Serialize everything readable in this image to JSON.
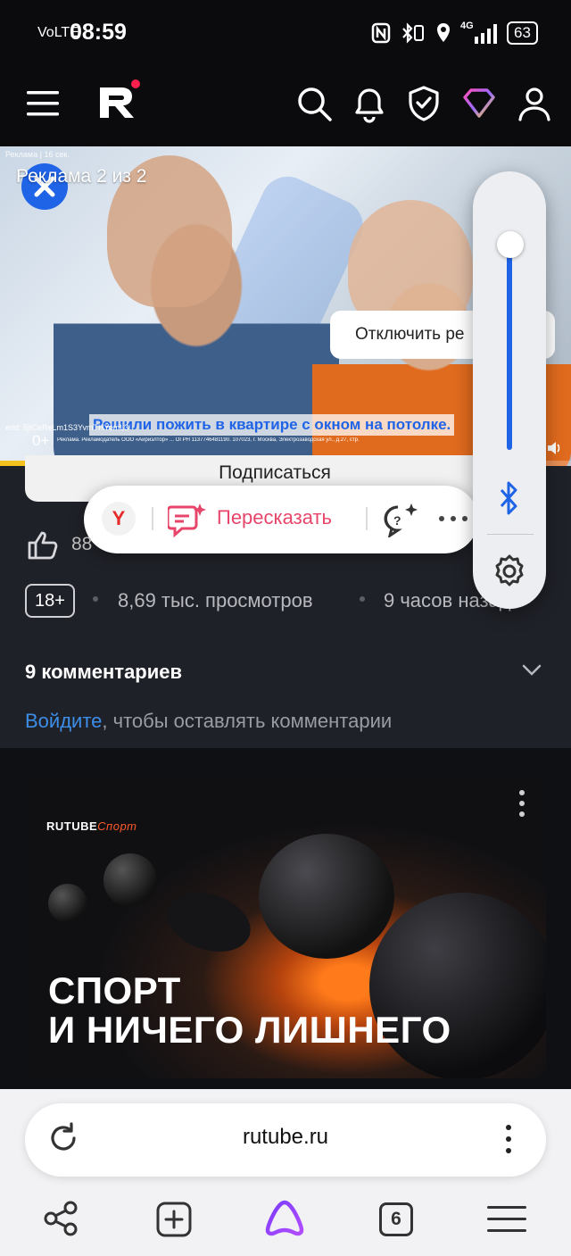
{
  "status_bar": {
    "volte": "VoLTE",
    "time": "08:59",
    "network": "4G",
    "battery": "63"
  },
  "video": {
    "ad_label": "Реклама | 16 сек.",
    "ad_counter": "Реклама 2 из 2",
    "mute_button_label": "Отключить ре",
    "ad_banner_text": "Решили пожить в квартире с окном на потолке.",
    "erid_text": "erid: 5jtCeReLm1S3YvmTHYemL3",
    "age_rating": "0+",
    "legal_text": "Реклама. Рекламодатель ООО «Айриэлтор» ... ОГРН 1137746481190. 107023, г. Москва, Электрозаводская ул., д.27, стр.",
    "progress": 0.21
  },
  "content": {
    "subscribe_label": "Подписаться",
    "assistant": {
      "yandex_letter": "Y",
      "retell_label": "Пересказать"
    },
    "likes_count": "88",
    "age_badge": "18+",
    "views": "8,69 тыс. просмотров",
    "published": "9 часов назад",
    "comments_title": "9 комментариев",
    "login_link": "Войдите",
    "login_rest": ", чтобы оставлять комментарии"
  },
  "promo_card": {
    "brand_main": "RUTUBE",
    "brand_sub": "Спорт",
    "headline_line1": "СПОРТ",
    "headline_line2": "И НИЧЕГО ЛИШНЕГО"
  },
  "volume": {
    "level": 0.92
  },
  "browser": {
    "url": "rutube.ru",
    "tabs_count": "6"
  },
  "colors": {
    "accent_blue": "#1f63e6",
    "retell_pink": "#e8456b",
    "brand_orange": "#ff5a2a",
    "progress_yellow": "#f4c21f"
  }
}
